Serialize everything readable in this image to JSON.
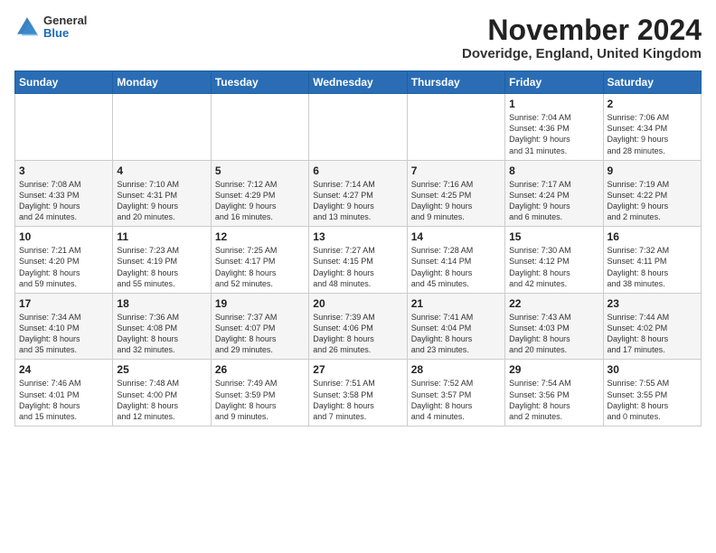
{
  "logo": {
    "general": "General",
    "blue": "Blue"
  },
  "title": "November 2024",
  "location": "Doveridge, England, United Kingdom",
  "days_of_week": [
    "Sunday",
    "Monday",
    "Tuesday",
    "Wednesday",
    "Thursday",
    "Friday",
    "Saturday"
  ],
  "weeks": [
    [
      {
        "day": "",
        "info": ""
      },
      {
        "day": "",
        "info": ""
      },
      {
        "day": "",
        "info": ""
      },
      {
        "day": "",
        "info": ""
      },
      {
        "day": "",
        "info": ""
      },
      {
        "day": "1",
        "info": "Sunrise: 7:04 AM\nSunset: 4:36 PM\nDaylight: 9 hours\nand 31 minutes."
      },
      {
        "day": "2",
        "info": "Sunrise: 7:06 AM\nSunset: 4:34 PM\nDaylight: 9 hours\nand 28 minutes."
      }
    ],
    [
      {
        "day": "3",
        "info": "Sunrise: 7:08 AM\nSunset: 4:33 PM\nDaylight: 9 hours\nand 24 minutes."
      },
      {
        "day": "4",
        "info": "Sunrise: 7:10 AM\nSunset: 4:31 PM\nDaylight: 9 hours\nand 20 minutes."
      },
      {
        "day": "5",
        "info": "Sunrise: 7:12 AM\nSunset: 4:29 PM\nDaylight: 9 hours\nand 16 minutes."
      },
      {
        "day": "6",
        "info": "Sunrise: 7:14 AM\nSunset: 4:27 PM\nDaylight: 9 hours\nand 13 minutes."
      },
      {
        "day": "7",
        "info": "Sunrise: 7:16 AM\nSunset: 4:25 PM\nDaylight: 9 hours\nand 9 minutes."
      },
      {
        "day": "8",
        "info": "Sunrise: 7:17 AM\nSunset: 4:24 PM\nDaylight: 9 hours\nand 6 minutes."
      },
      {
        "day": "9",
        "info": "Sunrise: 7:19 AM\nSunset: 4:22 PM\nDaylight: 9 hours\nand 2 minutes."
      }
    ],
    [
      {
        "day": "10",
        "info": "Sunrise: 7:21 AM\nSunset: 4:20 PM\nDaylight: 8 hours\nand 59 minutes."
      },
      {
        "day": "11",
        "info": "Sunrise: 7:23 AM\nSunset: 4:19 PM\nDaylight: 8 hours\nand 55 minutes."
      },
      {
        "day": "12",
        "info": "Sunrise: 7:25 AM\nSunset: 4:17 PM\nDaylight: 8 hours\nand 52 minutes."
      },
      {
        "day": "13",
        "info": "Sunrise: 7:27 AM\nSunset: 4:15 PM\nDaylight: 8 hours\nand 48 minutes."
      },
      {
        "day": "14",
        "info": "Sunrise: 7:28 AM\nSunset: 4:14 PM\nDaylight: 8 hours\nand 45 minutes."
      },
      {
        "day": "15",
        "info": "Sunrise: 7:30 AM\nSunset: 4:12 PM\nDaylight: 8 hours\nand 42 minutes."
      },
      {
        "day": "16",
        "info": "Sunrise: 7:32 AM\nSunset: 4:11 PM\nDaylight: 8 hours\nand 38 minutes."
      }
    ],
    [
      {
        "day": "17",
        "info": "Sunrise: 7:34 AM\nSunset: 4:10 PM\nDaylight: 8 hours\nand 35 minutes."
      },
      {
        "day": "18",
        "info": "Sunrise: 7:36 AM\nSunset: 4:08 PM\nDaylight: 8 hours\nand 32 minutes."
      },
      {
        "day": "19",
        "info": "Sunrise: 7:37 AM\nSunset: 4:07 PM\nDaylight: 8 hours\nand 29 minutes."
      },
      {
        "day": "20",
        "info": "Sunrise: 7:39 AM\nSunset: 4:06 PM\nDaylight: 8 hours\nand 26 minutes."
      },
      {
        "day": "21",
        "info": "Sunrise: 7:41 AM\nSunset: 4:04 PM\nDaylight: 8 hours\nand 23 minutes."
      },
      {
        "day": "22",
        "info": "Sunrise: 7:43 AM\nSunset: 4:03 PM\nDaylight: 8 hours\nand 20 minutes."
      },
      {
        "day": "23",
        "info": "Sunrise: 7:44 AM\nSunset: 4:02 PM\nDaylight: 8 hours\nand 17 minutes."
      }
    ],
    [
      {
        "day": "24",
        "info": "Sunrise: 7:46 AM\nSunset: 4:01 PM\nDaylight: 8 hours\nand 15 minutes."
      },
      {
        "day": "25",
        "info": "Sunrise: 7:48 AM\nSunset: 4:00 PM\nDaylight: 8 hours\nand 12 minutes."
      },
      {
        "day": "26",
        "info": "Sunrise: 7:49 AM\nSunset: 3:59 PM\nDaylight: 8 hours\nand 9 minutes."
      },
      {
        "day": "27",
        "info": "Sunrise: 7:51 AM\nSunset: 3:58 PM\nDaylight: 8 hours\nand 7 minutes."
      },
      {
        "day": "28",
        "info": "Sunrise: 7:52 AM\nSunset: 3:57 PM\nDaylight: 8 hours\nand 4 minutes."
      },
      {
        "day": "29",
        "info": "Sunrise: 7:54 AM\nSunset: 3:56 PM\nDaylight: 8 hours\nand 2 minutes."
      },
      {
        "day": "30",
        "info": "Sunrise: 7:55 AM\nSunset: 3:55 PM\nDaylight: 8 hours\nand 0 minutes."
      }
    ]
  ]
}
